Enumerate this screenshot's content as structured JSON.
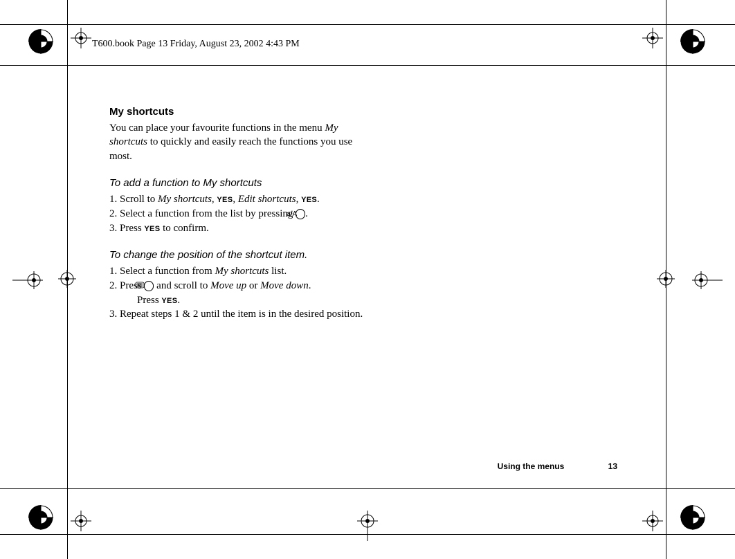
{
  "header": {
    "text": "T600.book  Page 13  Friday, August 23, 2002  4:43 PM"
  },
  "content": {
    "h1": "My shortcuts",
    "intro_1": "You can place your favourite functions in the menu ",
    "intro_em": "My shortcuts",
    "intro_2": " to quickly and easily reach the functions you use most.",
    "sec_a_title": "To add a function to My shortcuts",
    "a1_pre": "Scroll to ",
    "a1_em1": "My shortcuts",
    "a1_mid1": ", ",
    "a1_yes1": "YES",
    "a1_mid2": ", ",
    "a1_em2": "Edit shortcuts",
    "a1_mid3": ", ",
    "a1_yes2": "YES",
    "a1_end": ".",
    "a2_pre": "Select a function from the list by pressing ",
    "a2_key": "a/A",
    "a2_end": ".",
    "a3_pre": "Press ",
    "a3_yes": "YES",
    "a3_end": " to confirm.",
    "sec_b_title": "To change the position of the shortcut item.",
    "b1_pre": "Select a function from ",
    "b1_em": "My shortcuts",
    "b1_end": " list.",
    "b2_pre": "Press ",
    "b2_mid": " and scroll to ",
    "b2_em1": "Move up",
    "b2_or": " or ",
    "b2_em2": "Move down",
    "b2_end": ". ",
    "b2_wrap_pre": "Press ",
    "b2_wrap_yes": "YES",
    "b2_wrap_end": ".",
    "b3": "Repeat steps 1 & 2 until the item is in the desired position."
  },
  "footer": {
    "section": "Using the menus",
    "page": "13"
  }
}
